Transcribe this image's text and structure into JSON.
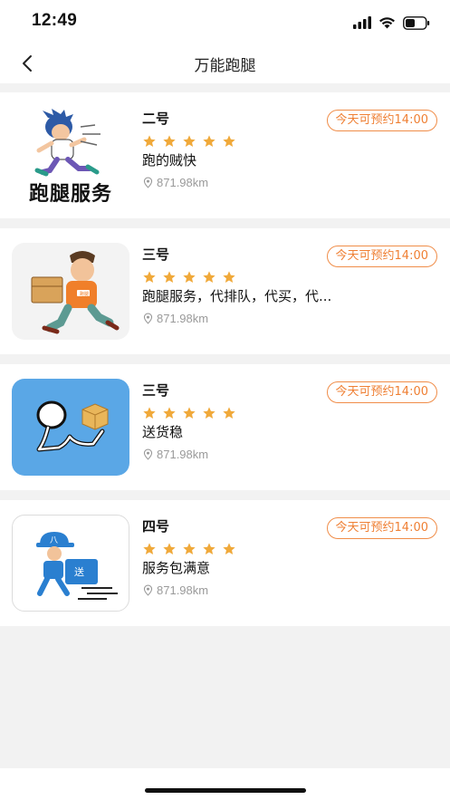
{
  "status_bar": {
    "time": "12:49"
  },
  "nav": {
    "title": "万能跑腿"
  },
  "services": [
    {
      "name": "二号",
      "rating": 5,
      "description": "跑的贼快",
      "distance": "871.98km",
      "availability": "今天可预约14:00",
      "image_text": "跑腿服务"
    },
    {
      "name": "三号",
      "rating": 5,
      "description": "跑腿服务，代排队，代买，代...",
      "distance": "871.98km",
      "availability": "今天可预约14:00",
      "image_text": "跑腿"
    },
    {
      "name": "三号",
      "rating": 5,
      "description": "送货稳",
      "distance": "871.98km",
      "availability": "今天可预约14:00",
      "image_text": ""
    },
    {
      "name": "四号",
      "rating": 5,
      "description": "服务包满意",
      "distance": "871.98km",
      "availability": "今天可预约14:00",
      "image_text": "八 送"
    }
  ],
  "colors": {
    "accent": "#ef7f33",
    "star": "#f0a93a"
  },
  "icons": {
    "back": "chevron-left-icon",
    "location": "location-pin-icon",
    "star": "star-icon"
  }
}
